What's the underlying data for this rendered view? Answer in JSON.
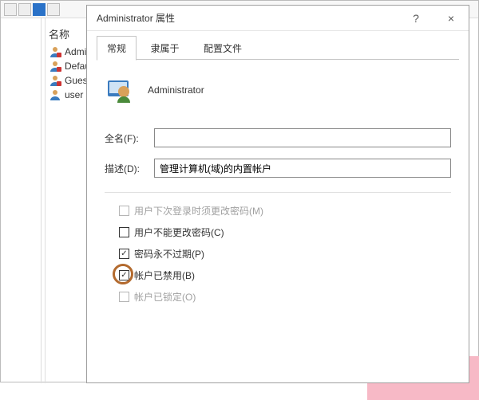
{
  "bg": {
    "header": "名称",
    "items": [
      {
        "label": "Admini"
      },
      {
        "label": "Defau"
      },
      {
        "label": "Gues"
      },
      {
        "label": "user"
      }
    ]
  },
  "dialog": {
    "title": "Administrator 属性",
    "help": "?",
    "close": "×",
    "tabs": {
      "general": "常规",
      "member": "隶属于",
      "profile": "配置文件"
    },
    "user_name": "Administrator",
    "full_name_label": "全名(F):",
    "full_name_value": "",
    "desc_label": "描述(D):",
    "desc_value": "管理计算机(域)的内置帐户",
    "checks": {
      "must_change": "用户下次登录时须更改密码(M)",
      "cannot_change": "用户不能更改密码(C)",
      "never_expire": "密码永不过期(P)",
      "disabled": "帐户已禁用(B)",
      "locked": "帐户已锁定(O)"
    }
  }
}
